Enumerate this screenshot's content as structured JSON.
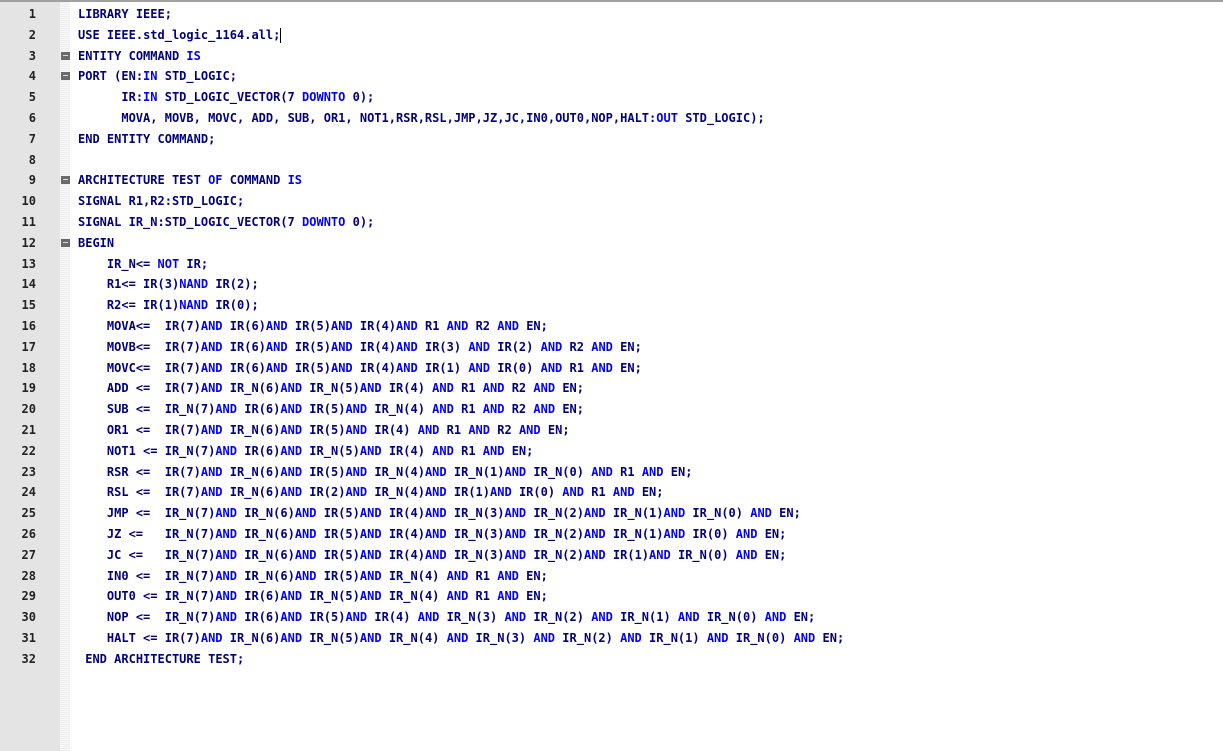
{
  "editor": {
    "lines": [
      {
        "n": "1",
        "fold": false,
        "code": "LIBRARY IEEE;"
      },
      {
        "n": "2",
        "fold": false,
        "code": "USE IEEE.std_logic_1164.all;",
        "cursor": true
      },
      {
        "n": "3",
        "fold": true,
        "code": "ENTITY COMMAND IS"
      },
      {
        "n": "4",
        "fold": true,
        "code": "PORT (EN:IN STD_LOGIC;"
      },
      {
        "n": "5",
        "fold": false,
        "code": "      IR:IN STD_LOGIC_VECTOR(7 DOWNTO 0);"
      },
      {
        "n": "6",
        "fold": false,
        "code": "      MOVA, MOVB, MOVC, ADD, SUB, OR1, NOT1,RSR,RSL,JMP,JZ,JC,IN0,OUT0,NOP,HALT:OUT STD_LOGIC);"
      },
      {
        "n": "7",
        "fold": false,
        "code": "END ENTITY COMMAND;"
      },
      {
        "n": "8",
        "fold": false,
        "code": ""
      },
      {
        "n": "9",
        "fold": true,
        "code": "ARCHITECTURE TEST OF COMMAND IS"
      },
      {
        "n": "10",
        "fold": false,
        "code": "SIGNAL R1,R2:STD_LOGIC;"
      },
      {
        "n": "11",
        "fold": false,
        "code": "SIGNAL IR_N:STD_LOGIC_VECTOR(7 DOWNTO 0);"
      },
      {
        "n": "12",
        "fold": true,
        "code": "BEGIN"
      },
      {
        "n": "13",
        "fold": false,
        "code": "    IR_N<= NOT IR;"
      },
      {
        "n": "14",
        "fold": false,
        "code": "    R1<= IR(3)NAND IR(2);"
      },
      {
        "n": "15",
        "fold": false,
        "code": "    R2<= IR(1)NAND IR(0);"
      },
      {
        "n": "16",
        "fold": false,
        "code": "    MOVA<=  IR(7)AND IR(6)AND IR(5)AND IR(4)AND R1 AND R2 AND EN;"
      },
      {
        "n": "17",
        "fold": false,
        "code": "    MOVB<=  IR(7)AND IR(6)AND IR(5)AND IR(4)AND IR(3) AND IR(2) AND R2 AND EN;"
      },
      {
        "n": "18",
        "fold": false,
        "code": "    MOVC<=  IR(7)AND IR(6)AND IR(5)AND IR(4)AND IR(1) AND IR(0) AND R1 AND EN;"
      },
      {
        "n": "19",
        "fold": false,
        "code": "    ADD <=  IR(7)AND IR_N(6)AND IR_N(5)AND IR(4) AND R1 AND R2 AND EN;"
      },
      {
        "n": "20",
        "fold": false,
        "code": "    SUB <=  IR_N(7)AND IR(6)AND IR(5)AND IR_N(4) AND R1 AND R2 AND EN;"
      },
      {
        "n": "21",
        "fold": false,
        "code": "    OR1 <=  IR(7)AND IR_N(6)AND IR(5)AND IR(4) AND R1 AND R2 AND EN;"
      },
      {
        "n": "22",
        "fold": false,
        "code": "    NOT1 <= IR_N(7)AND IR(6)AND IR_N(5)AND IR(4) AND R1 AND EN;"
      },
      {
        "n": "23",
        "fold": false,
        "code": "    RSR <=  IR(7)AND IR_N(6)AND IR(5)AND IR_N(4)AND IR_N(1)AND IR_N(0) AND R1 AND EN;"
      },
      {
        "n": "24",
        "fold": false,
        "code": "    RSL <=  IR(7)AND IR_N(6)AND IR(2)AND IR_N(4)AND IR(1)AND IR(0) AND R1 AND EN;"
      },
      {
        "n": "25",
        "fold": false,
        "code": "    JMP <=  IR_N(7)AND IR_N(6)AND IR(5)AND IR(4)AND IR_N(3)AND IR_N(2)AND IR_N(1)AND IR_N(0) AND EN;"
      },
      {
        "n": "26",
        "fold": false,
        "code": "    JZ <=   IR_N(7)AND IR_N(6)AND IR(5)AND IR(4)AND IR_N(3)AND IR_N(2)AND IR_N(1)AND IR(0) AND EN;"
      },
      {
        "n": "27",
        "fold": false,
        "code": "    JC <=   IR_N(7)AND IR_N(6)AND IR(5)AND IR(4)AND IR_N(3)AND IR_N(2)AND IR(1)AND IR_N(0) AND EN;"
      },
      {
        "n": "28",
        "fold": false,
        "code": "    IN0 <=  IR_N(7)AND IR_N(6)AND IR(5)AND IR_N(4) AND R1 AND EN;"
      },
      {
        "n": "29",
        "fold": false,
        "code": "    OUT0 <= IR_N(7)AND IR(6)AND IR_N(5)AND IR_N(4) AND R1 AND EN;"
      },
      {
        "n": "30",
        "fold": false,
        "code": "    NOP <=  IR_N(7)AND IR(6)AND IR(5)AND IR(4) AND IR_N(3) AND IR_N(2) AND IR_N(1) AND IR_N(0) AND EN;"
      },
      {
        "n": "31",
        "fold": false,
        "code": "    HALT <= IR(7)AND IR_N(6)AND IR_N(5)AND IR_N(4) AND IR_N(3) AND IR_N(2) AND IR_N(1) AND IR_N(0) AND EN;"
      },
      {
        "n": "32",
        "fold": false,
        "code": " END ARCHITECTURE TEST;"
      }
    ],
    "keywords": [
      "NOT",
      "NAND",
      "AND",
      "OF",
      "IS",
      "IN",
      "OUT",
      "DOWNTO"
    ],
    "colors": {
      "keyword": "#0000ff",
      "text": "#000080",
      "line_number": "#222222",
      "gutter": "#e4e4e4"
    }
  }
}
